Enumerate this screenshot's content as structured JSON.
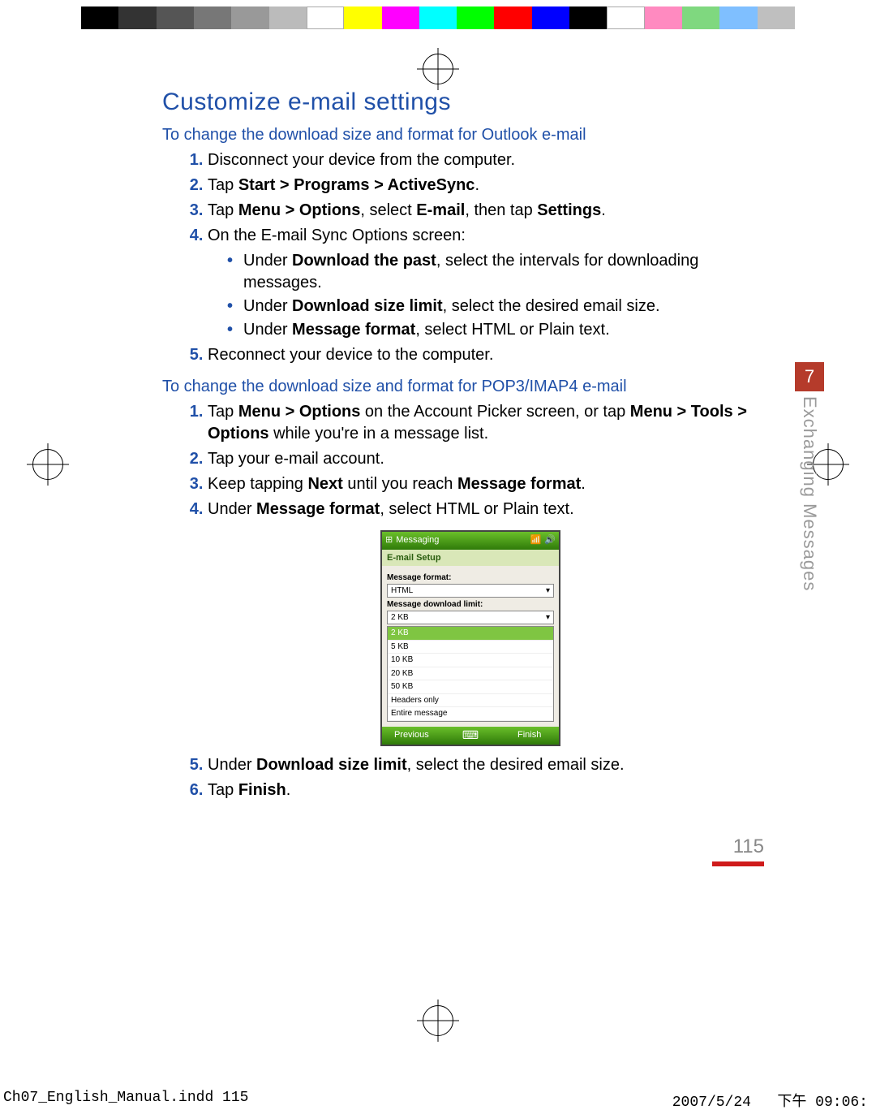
{
  "section_title": "Customize e-mail settings",
  "headings": {
    "outlook": "To change the download size and format for Outlook e-mail",
    "pop3": "To change the download size and format for POP3/IMAP4 e-mail"
  },
  "outlook_steps": {
    "s1": "Disconnect your device from the computer.",
    "s2_pre": "Tap ",
    "s2_path": "Start > Programs > ActiveSync",
    "s2_post": ".",
    "s3_a": "Tap ",
    "s3_b": "Menu > Options",
    "s3_c": ", select ",
    "s3_d": "E-mail",
    "s3_e": ", then tap ",
    "s3_f": "Settings",
    "s3_g": ".",
    "s4": "On the E-mail Sync Options screen:",
    "s4_b1_a": "Under ",
    "s4_b1_b": "Download the past",
    "s4_b1_c": ", select the intervals for downloading messages.",
    "s4_b2_a": "Under ",
    "s4_b2_b": "Download size limit",
    "s4_b2_c": ", select the desired email size.",
    "s4_b3_a": "Under ",
    "s4_b3_b": "Message format",
    "s4_b3_c": ", select HTML or Plain text.",
    "s5": "Reconnect your device to the computer."
  },
  "pop3_steps": {
    "s1_a": "Tap ",
    "s1_b": "Menu > Options",
    "s1_c": " on the Account Picker screen, or tap ",
    "s1_d": "Menu > Tools > Options",
    "s1_e": " while you're in a message list.",
    "s2": "Tap your e-mail account.",
    "s3_a": "Keep tapping ",
    "s3_b": "Next",
    "s3_c": " until you reach ",
    "s3_d": "Message format",
    "s3_e": ".",
    "s4_a": "Under ",
    "s4_b": "Message format",
    "s4_c": ", select HTML or Plain text.",
    "s5_a": "Under ",
    "s5_b": "Download size limit",
    "s5_c": ", select the desired email size.",
    "s6_a": "Tap ",
    "s6_b": "Finish",
    "s6_c": "."
  },
  "device_screenshot": {
    "top_title": "Messaging",
    "subbar": "E-mail Setup",
    "label_format": "Message format:",
    "format_value": "HTML",
    "label_limit": "Message download limit:",
    "limit_value": "2 KB",
    "options": [
      "2 KB",
      "5 KB",
      "10 KB",
      "20 KB",
      "50 KB",
      "Headers only",
      "Entire message"
    ],
    "soft_left": "Previous",
    "soft_right": "Finish"
  },
  "chapter": {
    "number": "7",
    "title": "Exchanging Messages"
  },
  "page_number": "115",
  "print_footer": {
    "file": "Ch07_English_Manual.indd   115",
    "date": "2007/5/24",
    "time": "下午 09:06:"
  },
  "colorbar": [
    "#000000",
    "#333333",
    "#555555",
    "#777777",
    "#999999",
    "#bbbbbb",
    "#ffffff",
    "#ffff00",
    "#ff00ff",
    "#00ffff",
    "#00ff00",
    "#ff0000",
    "#0000ff",
    "#000000",
    "#ffffff",
    "#ff8ac0",
    "#7fd87f",
    "#7fbfff",
    "#bfbfbf"
  ]
}
